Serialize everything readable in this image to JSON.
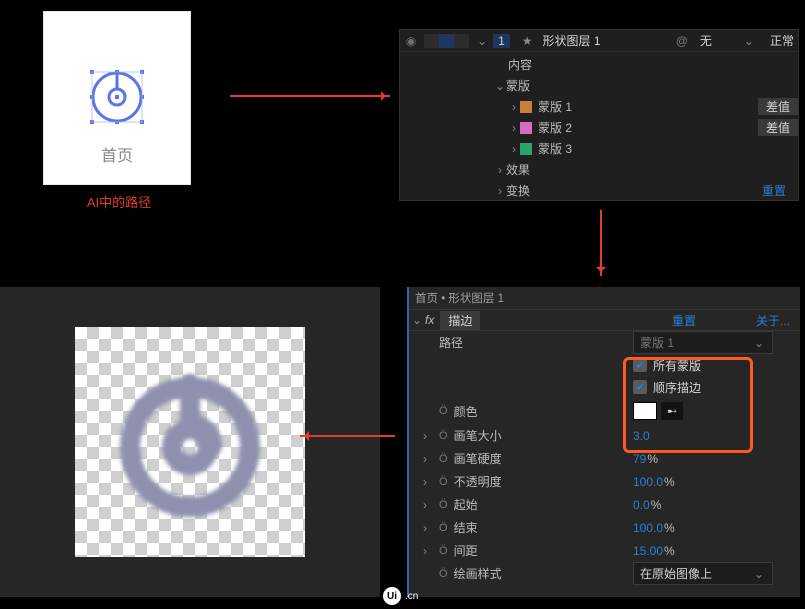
{
  "panelA": {
    "tab_label": "首页",
    "caption": "AI中的路径"
  },
  "panelB": {
    "layer_index": "1",
    "layer_name": "形状图层 1",
    "track_matte": "无",
    "blend_mode": "正常",
    "rows": {
      "contents": "内容",
      "masks": "蒙版",
      "mask1": "蒙版 1",
      "mask2": "蒙版 2",
      "mask3": "蒙版 3",
      "effects": "效果",
      "transform": "变换"
    },
    "mask_mode": "差值",
    "reset": "重置",
    "mask_colors": {
      "m1": "#c8813c",
      "m2": "#d66cc3",
      "m3": "#2aa36f"
    }
  },
  "panelC": {
    "title": "首页 • 形状图层 1",
    "fx_name": "描边",
    "reset": "重置",
    "about": "关于...",
    "path_label": "路径",
    "path_value": "蒙版 1",
    "all_masks": "所有蒙版",
    "seq_stroke": "顺序描边",
    "color_label": "颜色",
    "color_value": "#ffffff",
    "props": [
      {
        "name": "画笔大小",
        "value": "3.0",
        "unit": ""
      },
      {
        "name": "画笔硬度",
        "value": "79",
        "unit": "%"
      },
      {
        "name": "不透明度",
        "value": "100.0",
        "unit": "%"
      },
      {
        "name": "起始",
        "value": "0.0",
        "unit": "%"
      },
      {
        "name": "结束",
        "value": "100.0",
        "unit": "%"
      },
      {
        "name": "间距",
        "value": "15.00",
        "unit": "%"
      }
    ],
    "paint_style_label": "绘画样式",
    "paint_style_value": "在原始图像上"
  },
  "watermark": {
    "left": "Ui",
    "right": ".cn"
  }
}
